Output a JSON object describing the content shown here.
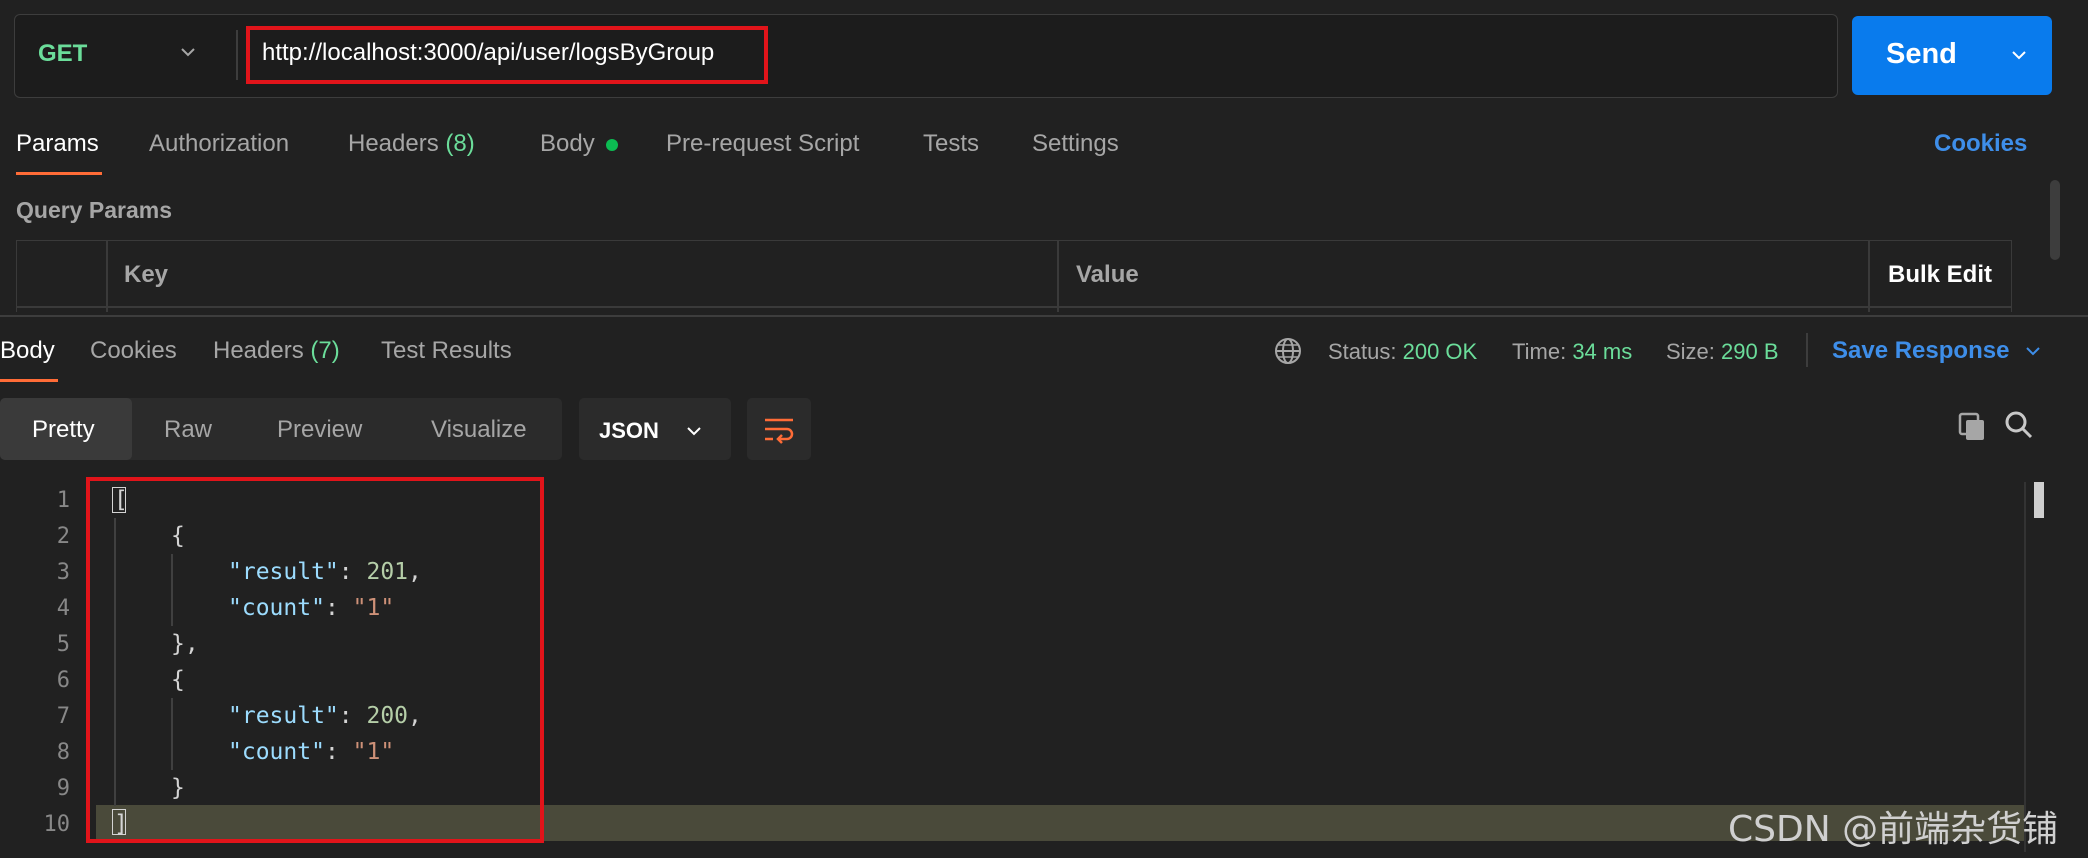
{
  "request": {
    "method": "GET",
    "url": "http://localhost:3000/api/user/logsByGroup",
    "send_label": "Send"
  },
  "request_tabs": {
    "params": "Params",
    "authorization": "Authorization",
    "headers": "Headers",
    "headers_count": "(8)",
    "body": "Body",
    "prerequest": "Pre-request Script",
    "tests": "Tests",
    "settings": "Settings",
    "cookies": "Cookies"
  },
  "query_params": {
    "title": "Query Params",
    "col_key": "Key",
    "col_value": "Value",
    "bulk_edit": "Bulk Edit"
  },
  "response_tabs": {
    "body": "Body",
    "cookies": "Cookies",
    "headers": "Headers",
    "headers_count": "(7)",
    "test_results": "Test Results"
  },
  "response_status": {
    "status_label": "Status:",
    "status_value": "200 OK",
    "time_label": "Time:",
    "time_value": "34 ms",
    "size_label": "Size:",
    "size_value": "290 B",
    "save_response": "Save Response"
  },
  "view_modes": {
    "pretty": "Pretty",
    "raw": "Raw",
    "preview": "Preview",
    "visualize": "Visualize",
    "format": "JSON"
  },
  "code": {
    "line_numbers": [
      "1",
      "2",
      "3",
      "4",
      "5",
      "6",
      "7",
      "8",
      "9",
      "10"
    ],
    "open_bracket": "[",
    "open_brace": "{",
    "close_brace_comma": "},",
    "close_brace": "}",
    "close_bracket": "]",
    "items": [
      {
        "result_key": "\"result\"",
        "result_value": "201",
        "count_key": "\"count\"",
        "count_value": "\"1\""
      },
      {
        "result_key": "\"result\"",
        "result_value": "200",
        "count_key": "\"count\"",
        "count_value": "\"1\""
      }
    ]
  },
  "icons": {
    "method_chevron": "chevron-down-icon",
    "send_chevron": "chevron-down-icon",
    "globe": "globe-icon",
    "wrap": "wrap-lines-icon",
    "copy": "copy-icon",
    "search": "search-icon"
  },
  "colors": {
    "accent_orange": "#ff6c37",
    "send_blue": "#097bed",
    "link_blue": "#3e8ee9",
    "success_green": "#6bdd9a",
    "highlight_red": "#e1141a"
  },
  "watermark": "CSDN @前端杂货铺"
}
